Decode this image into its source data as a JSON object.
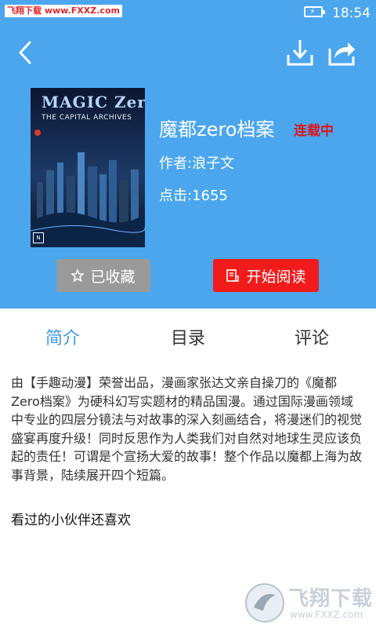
{
  "status_bar": {
    "watermark": "飞翔下载 www.FXXZ.com",
    "time": "18:54"
  },
  "book": {
    "title": "魔都zero档案",
    "serial_status": "连载中",
    "author": "作者:浪子文",
    "clicks": "点击:1655",
    "cover": {
      "logo": "MAGIC Zero",
      "subtitle": "THE CAPITAL ARCHIVES"
    }
  },
  "actions": {
    "favorite": "已收藏",
    "read": "开始阅读"
  },
  "tabs": [
    {
      "label": "简介",
      "active": true
    },
    {
      "label": "目录",
      "active": false
    },
    {
      "label": "评论",
      "active": false
    }
  ],
  "description": "由【手趣动漫】荣誉出品，漫画家张达文亲自操刀的《魔都Zero档案》为硬科幻写实题材的精品国漫。通过国际漫画领域中专业的四层分镜法与对故事的深入刻画结合，将漫迷们的视觉盛宴再度升级！同时反思作为人类我们对自然对地球生灵应该负起的责任！可谓是个宣扬大爱的故事！整个作品以魔都上海为故事背景，陆续展开四个短篇。",
  "recommend_title": "看过的小伙伴还喜欢",
  "watermark_br": {
    "brand": "飞翔下载",
    "url": "www.FXXZ.com"
  },
  "colors": {
    "header_bg": "#4ba6ee",
    "accent_tab": "#3d9be6",
    "serial_status": "#e0141b",
    "read_button": "#f21b1b",
    "favorite_button": "#9a9a9a"
  },
  "icons": [
    "back-arrow-icon",
    "download-icon",
    "share-icon",
    "star-outline-icon",
    "book-icon",
    "battery-charging-icon"
  ]
}
